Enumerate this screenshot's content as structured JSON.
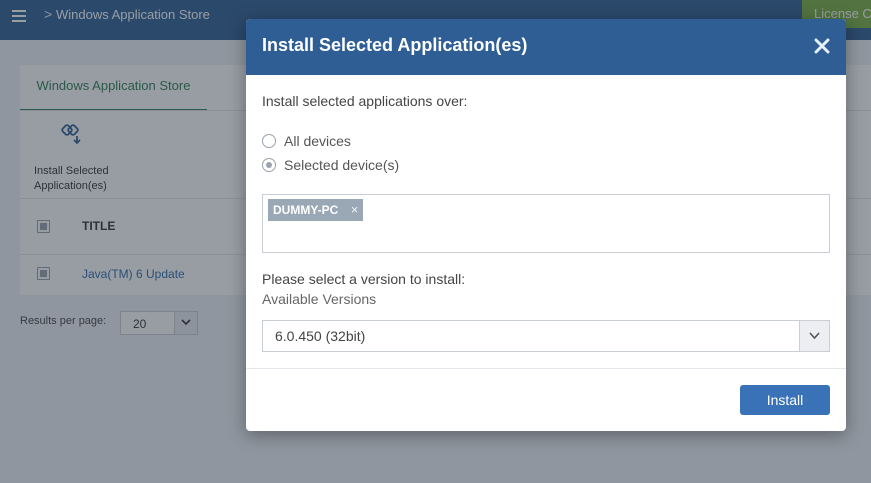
{
  "app": {
    "breadcrumb_separator": ">",
    "breadcrumb": "Windows Application Store",
    "license_button": "License C"
  },
  "store": {
    "tab_label": "Windows Application Store",
    "toolbar": {
      "install_label": "Install Selected Application(es)",
      "install_icon": "app-install-icon"
    },
    "table": {
      "column_title": "TITLE",
      "rows": [
        {
          "title": "Java(TM) 6 Update"
        }
      ]
    },
    "pagination": {
      "label": "Results per page:",
      "value": "20"
    }
  },
  "dialog": {
    "title": "Install Selected Application(es)",
    "close_icon": "close-icon",
    "prompt": "Install selected applications over:",
    "options": [
      {
        "label": "All devices",
        "checked": false
      },
      {
        "label": "Selected device(s)",
        "checked": true
      }
    ],
    "selected_devices": [
      {
        "name": "DUMMY-PC",
        "remove": "×"
      }
    ],
    "version_prompt": "Please select a version to install:",
    "available_versions_label": "Available Versions",
    "version_value": "6.0.450 (32bit)",
    "install_button": "Install"
  },
  "colors": {
    "header_blue": "#2e5e93",
    "accent_green": "#2e7d4f",
    "button_blue": "#3a72b8",
    "license_green": "#7bb041"
  }
}
